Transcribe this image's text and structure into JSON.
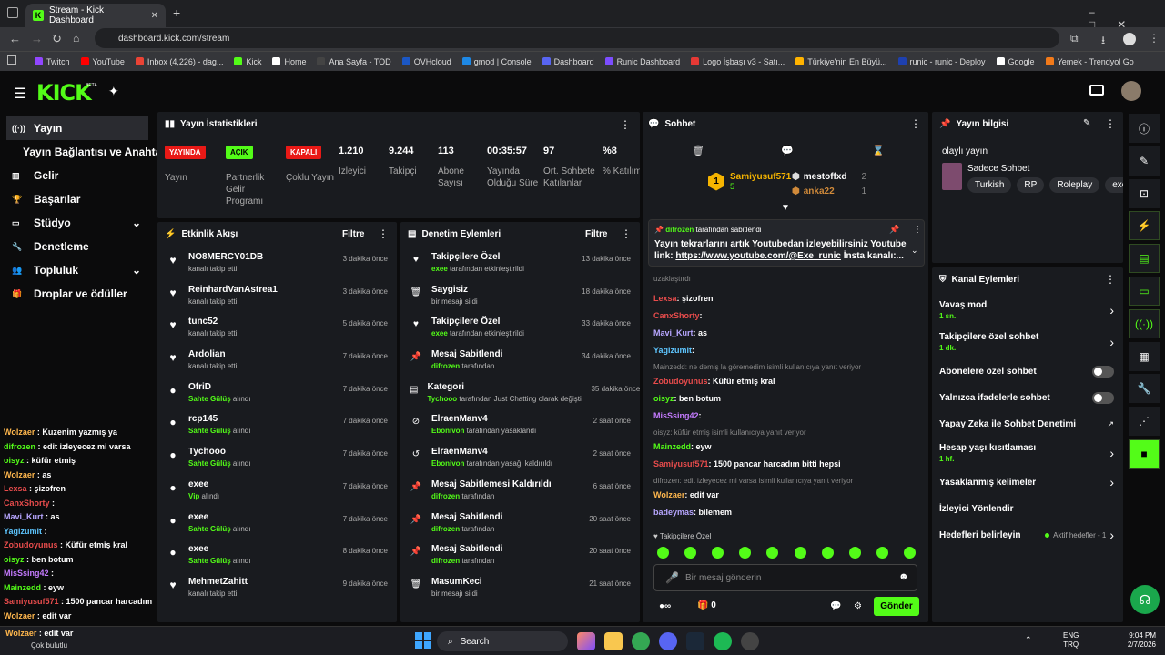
{
  "browser": {
    "tab_title": "Stream - Kick Dashboard",
    "url": "dashboard.kick.com/stream",
    "bookmarks": [
      {
        "label": "Twitch",
        "color": "#9146ff"
      },
      {
        "label": "YouTube",
        "color": "#ff0000"
      },
      {
        "label": "Inbox (4,226) - dag...",
        "color": "#ea4335"
      },
      {
        "label": "Kick",
        "color": "#53fc18"
      },
      {
        "label": "Home",
        "color": "#ffffff"
      },
      {
        "label": "Ana Sayfa - TOD",
        "color": "#444444"
      },
      {
        "label": "OVHcloud",
        "color": "#1b57c4"
      },
      {
        "label": "gmod | Console",
        "color": "#1e88e5"
      },
      {
        "label": "Dashboard",
        "color": "#5865f2"
      },
      {
        "label": "Runic Dashboard",
        "color": "#7c4dff"
      },
      {
        "label": "Logo İşbaşı v3 - Satı...",
        "color": "#e53935"
      },
      {
        "label": "Türkiye'nin En Büyü...",
        "color": "#ffb300"
      },
      {
        "label": "runic - runic - Deploy",
        "color": "#1e40af"
      },
      {
        "label": "Google",
        "color": "#ffffff"
      },
      {
        "label": "Yemek - Trendyol Go",
        "color": "#f27a1a"
      }
    ]
  },
  "kick": {
    "logo": "KICK",
    "beta": "BETA"
  },
  "sidenav": [
    {
      "label": "Yayın",
      "icon": "broadcast-icon",
      "active": true
    },
    {
      "label": "Yayın Bağlantısı ve Anahtarı",
      "icon": "",
      "sub": true
    },
    {
      "label": "Gelir",
      "icon": "chart-icon"
    },
    {
      "label": "Başarılar",
      "icon": "trophy-icon"
    },
    {
      "label": "Stüdyo",
      "icon": "studio-icon",
      "chevron": true
    },
    {
      "label": "Denetleme",
      "icon": "wrench-icon"
    },
    {
      "label": "Topluluk",
      "icon": "people-icon",
      "chevron": true
    },
    {
      "label": "Droplar ve ödüller",
      "icon": "gift-icon"
    }
  ],
  "stats": {
    "title": "Yayın İstatistikleri",
    "badges": [
      {
        "badge": "YAYINDA",
        "label": "Yayın",
        "color": "#e91916",
        "text": "#fff"
      },
      {
        "badge": "AÇIK",
        "label": "Partnerlik Gelir Programı",
        "color": "#53fc18",
        "text": "#000"
      },
      {
        "badge": "KAPALI",
        "label": "Çoklu Yayın",
        "color": "#e91916",
        "text": "#fff"
      }
    ],
    "items": [
      {
        "value": "1.210",
        "label": "İzleyici"
      },
      {
        "value": "9.244",
        "label": "Takipçi"
      },
      {
        "value": "113",
        "label": "Abone Sayısı"
      },
      {
        "value": "00:35:57",
        "label": "Yayında Olduğu Süre"
      },
      {
        "value": "97",
        "label": "Ort. Sohbete Katılanlar"
      },
      {
        "value": "%8",
        "label": "% Katılım"
      }
    ]
  },
  "activity": {
    "title": "Etkinlik Akışı",
    "filter": "Filtre",
    "items": [
      {
        "name": "NO8MERCY01DB",
        "sub": "kanalı takip etti",
        "time": "3 dakika önce",
        "icon": "heart-icon",
        "hl": ""
      },
      {
        "name": "ReinhardVanAstrea1",
        "sub": "kanalı takip etti",
        "time": "3 dakika önce",
        "icon": "heart-icon",
        "hl": ""
      },
      {
        "name": "tunc52",
        "sub": "kanalı takip etti",
        "time": "5 dakika önce",
        "icon": "heart-icon",
        "hl": ""
      },
      {
        "name": "Ardolian",
        "sub": "kanalı takip etti",
        "time": "7 dakika önce",
        "icon": "heart-icon",
        "hl": ""
      },
      {
        "name": "OfriD",
        "sub": " alındı",
        "time": "7 dakika önce",
        "icon": "gift-icon",
        "hl": "Sahte Gülüş"
      },
      {
        "name": "rcp145",
        "sub": " alındı",
        "time": "7 dakika önce",
        "icon": "gift-icon",
        "hl": "Sahte Gülüş"
      },
      {
        "name": "Tychooo",
        "sub": " alındı",
        "time": "7 dakika önce",
        "icon": "gift-icon",
        "hl": "Sahte Gülüş"
      },
      {
        "name": "exee",
        "sub": " alındı",
        "time": "7 dakika önce",
        "icon": "gift-icon",
        "hl": "Vip"
      },
      {
        "name": "exee",
        "sub": " alındı",
        "time": "7 dakika önce",
        "icon": "gift-icon",
        "hl": "Sahte Gülüş"
      },
      {
        "name": "exee",
        "sub": " alındı",
        "time": "8 dakika önce",
        "icon": "gift-icon",
        "hl": "Sahte Gülüş"
      },
      {
        "name": "MehmetZahitt",
        "sub": "kanalı takip etti",
        "time": "9 dakika önce",
        "icon": "heart-icon",
        "hl": ""
      }
    ]
  },
  "moderation": {
    "title": "Denetim Eylemleri",
    "filter": "Filtre",
    "items": [
      {
        "name": "Takipçilere Özel",
        "who": "exee",
        "sub": " tarafından etkinleştirildi",
        "time": "13 dakika önce",
        "icon": "♥"
      },
      {
        "name": "Saygisiz",
        "who": "",
        "sub": "bir mesajı sildi",
        "time": "18 dakika önce",
        "icon": "🗑"
      },
      {
        "name": "Takipçilere Özel",
        "who": "exee",
        "sub": " tarafından etkinleştirildi",
        "time": "33 dakika önce",
        "icon": "♥"
      },
      {
        "name": "Mesaj Sabitlendi",
        "who": "difrozen",
        "sub": " tarafından",
        "time": "34 dakika önce",
        "icon": "📌"
      },
      {
        "name": "Kategori",
        "who": "Tychooo",
        "sub": " tarafından Just Chatting olarak değiştirildi",
        "time": "35 dakika önce",
        "icon": "▤"
      },
      {
        "name": "ElraenManv4",
        "who": "Ebonivon",
        "sub": " tarafından yasaklandı",
        "time": "2 saat önce",
        "icon": "⊘"
      },
      {
        "name": "ElraenManv4",
        "who": "Ebonivon",
        "sub": " tarafından yasağı kaldırıldı",
        "time": "2 saat önce",
        "icon": "↺"
      },
      {
        "name": "Mesaj Sabitlemesi Kaldırıldı",
        "who": "difrozen",
        "sub": " tarafından",
        "time": "6 saat önce",
        "icon": "📌"
      },
      {
        "name": "Mesaj Sabitlendi",
        "who": "difrozen",
        "sub": " tarafından",
        "time": "20 saat önce",
        "icon": "📌"
      },
      {
        "name": "Mesaj Sabitlendi",
        "who": "difrozen",
        "sub": " tarafından",
        "time": "20 saat önce",
        "icon": "📌"
      },
      {
        "name": "MasumKeci",
        "who": "",
        "sub": "bir mesajı sildi",
        "time": "21 saat önce",
        "icon": "🗑"
      }
    ]
  },
  "chat": {
    "title": "Sohbet",
    "top": [
      {
        "rank": "1",
        "name": "Samiyusuf571",
        "count": "5"
      },
      {
        "rank": "2",
        "name": "mestoffxd",
        "count": "2"
      },
      {
        "rank": "3",
        "name": "anka22",
        "count": "1"
      }
    ],
    "pinned_by": "difrozen",
    "pinned_suffix": " tarafından sabitlendi",
    "pinned_text": "Yayın tekrarlarını artık Youtubedan izleyebilirsiniz Youtube link: ",
    "pinned_link": "https://www.youtube.com/@Exe_runic",
    "pinned_tail": " İnsta kanalı:...",
    "removed": "uzaklaştırdı",
    "messages": [
      {
        "user": "Lexsa",
        "color": "#e84c4c",
        "text": ": şizofren"
      },
      {
        "user": "CanxShorty",
        "color": "#e84c4c",
        "text": ":"
      },
      {
        "user": "Mavi_Kurt",
        "color": "#b7a6ff",
        "text": ": as"
      },
      {
        "user": "Yagizumit",
        "color": "#5ec6ff",
        "text": ":"
      },
      {
        "reply": "Mainzedd: ne demiş la göremedim isimli kullanıcıya yanıt veriyor",
        "user": "Zobudoyunus",
        "color": "#e84c4c",
        "text": ": Küfür etmiş kral"
      },
      {
        "user": "oisyz",
        "color": "#53fc18",
        "text": ": ben botum"
      },
      {
        "user": "MisSsing42",
        "color": "#c57bff",
        "text": ":"
      },
      {
        "reply": "oisyz: küfür etmiş isimli kullanıcıya yanıt veriyor",
        "user": "Mainzedd",
        "color": "#53fc18",
        "text": ": eyw"
      },
      {
        "user": "Samiyusuf571",
        "color": "#e84c4c",
        "text": ": 1500 pancar harcadım bitti hepsi"
      },
      {
        "reply": "difrozen: edit izleyecez mi varsa isimli kullanıcıya yanıt veriyor",
        "user": "Wolzaer",
        "color": "#ffb74d",
        "text": ": edit var"
      },
      {
        "user": "badeymas",
        "color": "#b7a6ff",
        "text": ": bilemem"
      }
    ],
    "section": "Takipçilere Özel",
    "placeholder": "Bir mesaj gönderin",
    "count": "0",
    "send": "Gönder"
  },
  "overlay_chat": [
    {
      "user": "Wolzaer",
      "color": "#ffb74d",
      "text": " : Kuzenim yazmış ya"
    },
    {
      "user": "difrozen",
      "color": "#53fc18",
      "text": " : edit izleyecez mi varsa"
    },
    {
      "user": "oisyz",
      "color": "#53fc18",
      "text": " : küfür etmiş"
    },
    {
      "user": "Wolzaer",
      "color": "#ffb74d",
      "text": " : as"
    },
    {
      "user": "Lexsa",
      "color": "#e84c4c",
      "text": " : şizofren"
    },
    {
      "user": "CanxShorty",
      "color": "#e84c4c",
      "text": " :"
    },
    {
      "user": "Mavi_Kurt",
      "color": "#b7a6ff",
      "text": " : as"
    },
    {
      "user": "Yagizumit",
      "color": "#5ec6ff",
      "text": " :"
    },
    {
      "user": "Zobudoyunus",
      "color": "#e84c4c",
      "text": " : Küfür etmiş kral"
    },
    {
      "user": "oisyz",
      "color": "#53fc18",
      "text": " : ben botum"
    },
    {
      "user": "MisSsing42",
      "color": "#c57bff",
      "text": " :"
    },
    {
      "user": "Mainzedd",
      "color": "#53fc18",
      "text": " : eyw"
    },
    {
      "user": "Samiyusuf571",
      "color": "#e84c4c",
      "text": " : 1500 pancar harcadım bitti hepsi"
    },
    {
      "user": "Wolzaer",
      "color": "#ffb74d",
      "text": " : edit var"
    }
  ],
  "info": {
    "title": "Yayın bilgisi",
    "stream_title": "olaylı yayın",
    "category": "Sadece Sohbet",
    "tags": [
      "Turkish",
      "RP",
      "Roleplay",
      "exee"
    ]
  },
  "channel_actions": {
    "title": "Kanal Eylemleri",
    "items": [
      {
        "label": "Vavaş mod",
        "sub": "1 sn.",
        "control": "chevron"
      },
      {
        "label": "Takipçilere özel sohbet",
        "sub": "1 dk.",
        "control": "chevron"
      },
      {
        "label": "Abonelere özel sohbet",
        "sub": "",
        "control": "toggle"
      },
      {
        "label": "Yalnızca ifadelerle sohbet",
        "sub": "",
        "control": "toggle"
      },
      {
        "label": "Yapay Zeka ile Sohbet Denetimi",
        "sub": "",
        "control": "external"
      },
      {
        "label": "Hesap yaşı kısıtlaması",
        "sub": "1 hf.",
        "control": "chevron"
      },
      {
        "label": "Yasaklanmış kelimeler",
        "sub": "",
        "control": "chevron"
      },
      {
        "label": "İzleyici Yönlendir",
        "sub": "",
        "control": ""
      },
      {
        "label": "Hedefleri belirleyin",
        "sub": "",
        "control": "goal"
      }
    ],
    "goal_text": "Aktif hedefler - 1"
  },
  "taskbar": {
    "weather_user": "Wolzaer",
    "weather": "Çok bulutlu",
    "search": "Search",
    "lang1": "ENG",
    "lang2": "TRQ",
    "time": "9:04 PM",
    "date": "2/7/2026"
  }
}
